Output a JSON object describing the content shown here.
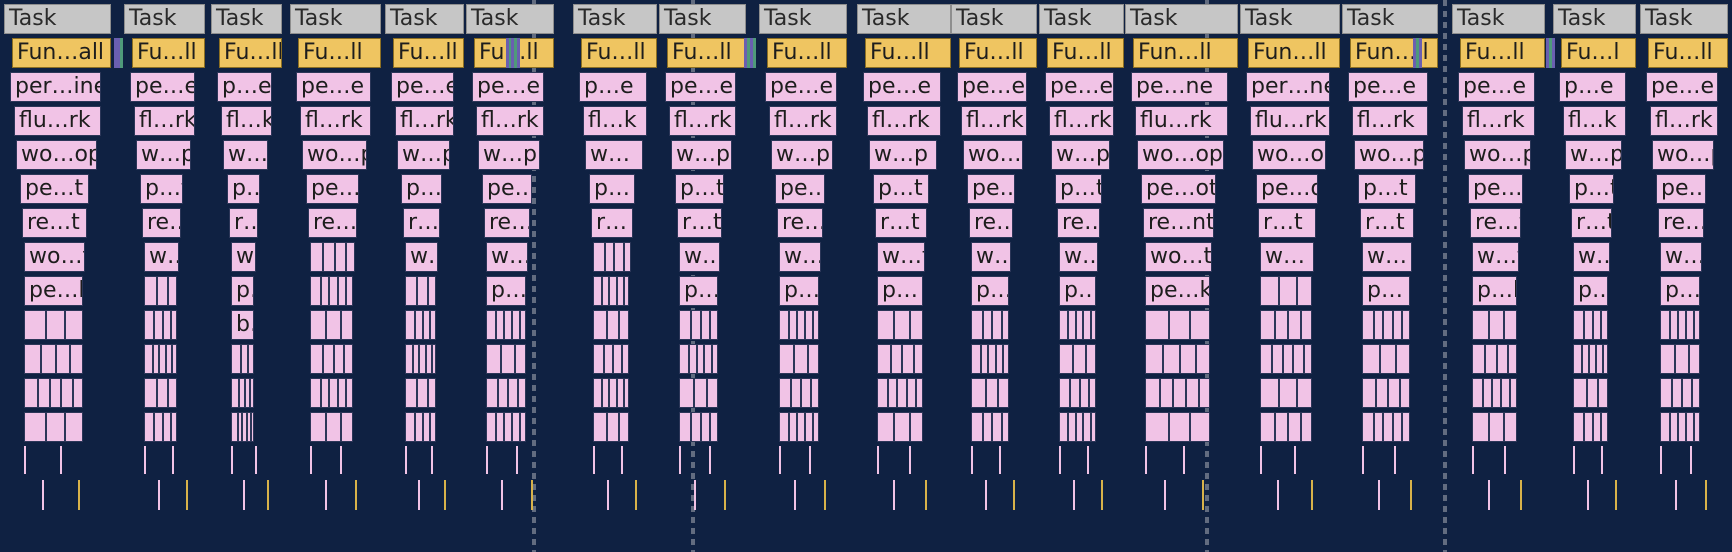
{
  "task_label": "Task",
  "tasks": [
    {
      "labels": [
        "Task",
        "Fun…all",
        "per…ine",
        "flu…rk",
        "wo…op",
        "pe…t",
        "re…t",
        "wo…t",
        "pe…k"
      ]
    },
    {
      "labels": [
        "Task",
        "Fu…ll",
        "pe…e",
        "fl…rk",
        "w…p",
        "p…t",
        "re…t",
        "w…t"
      ]
    },
    {
      "labels": [
        "Task",
        "Fu…ll",
        "p…e",
        "fl…k",
        "w…",
        "p…t",
        "r…t",
        "w…",
        "p…",
        "b…"
      ]
    },
    {
      "labels": [
        "Task",
        "Fu…ll",
        "pe…e",
        "fl…rk",
        "wo…p",
        "pe…t",
        "re…t"
      ]
    },
    {
      "labels": [
        "Task",
        "Fu…ll",
        "pe…e",
        "fl…rk",
        "w…p",
        "p…t",
        "r…t",
        "w…"
      ]
    },
    {
      "labels": [
        "Task",
        "Fu…ll",
        "pe…e",
        "fl…rk",
        "w…p",
        "pe…t",
        "re…t",
        "w…t",
        "p…k"
      ]
    },
    {
      "labels": [
        "Task",
        "Fu…ll",
        "p…e",
        "fl…k",
        "w…",
        "p…",
        "r…"
      ]
    },
    {
      "labels": [
        "Task",
        "Fu…ll",
        "pe…e",
        "fl…rk",
        "w…p",
        "p…t",
        "r…t",
        "w…",
        "p…"
      ]
    },
    {
      "labels": [
        "Task",
        "Fu…ll",
        "pe…e",
        "fl…rk",
        "w…p",
        "pe…t",
        "re…t",
        "w…t",
        "p…"
      ]
    },
    {
      "labels": [
        "Task",
        "Fu…ll",
        "pe…e",
        "fl…rk",
        "w…p",
        "p…t",
        "r…t",
        "w…t",
        "p…"
      ]
    },
    {
      "labels": [
        "Task",
        "Fu…ll",
        "pe…e",
        "fl…rk",
        "wo…p",
        "pe…t",
        "re…t",
        "w…t",
        "p…k"
      ]
    },
    {
      "labels": [
        "Task",
        "Fu…ll",
        "pe…e",
        "fl…rk",
        "w…p",
        "p…t",
        "re…t",
        "w…t",
        "p…k"
      ]
    },
    {
      "labels": [
        "Task",
        "Fun…ll",
        "pe…ne",
        "flu…rk",
        "wo…op",
        "pe…ot",
        "re…nt",
        "wo…t",
        "pe…k"
      ]
    },
    {
      "labels": [
        "Task",
        "Fun…ll",
        "per…ne",
        "flu…rk",
        "wo…op",
        "pe…ot",
        "r…t",
        "w…"
      ]
    },
    {
      "labels": [
        "Task",
        "Fun…ll",
        "pe…e",
        "fl…rk",
        "wo…p",
        "p…t",
        "r…t",
        "w…",
        "p…"
      ]
    },
    {
      "labels": [
        "Task",
        "Fu…ll",
        "pe…e",
        "fl…rk",
        "wo…p",
        "pe…t",
        "re…t",
        "w…t",
        "p…k"
      ]
    },
    {
      "labels": [
        "Task",
        "Fu…l",
        "p…e",
        "fl…k",
        "w…p",
        "p…t",
        "r…t",
        "w…",
        "p…"
      ]
    },
    {
      "labels": [
        "Task",
        "Fu…ll",
        "pe…e",
        "fl…rk",
        "wo…p",
        "pe…t",
        "re…t",
        "w…t",
        "p…k"
      ]
    }
  ]
}
